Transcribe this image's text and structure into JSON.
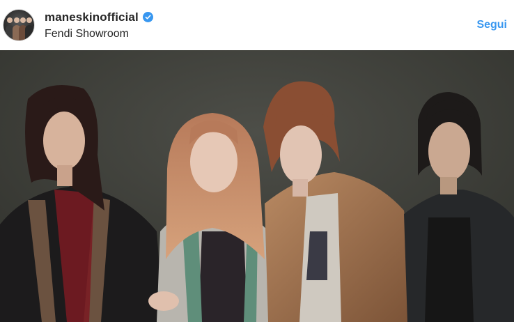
{
  "post": {
    "username": "maneskinofficial",
    "location": "Fendi Showroom",
    "follow_label": "Segui",
    "verified_color": "#3897f0"
  },
  "photo": {
    "subject": "four band members posing",
    "background_color": "#3e3f3a"
  }
}
